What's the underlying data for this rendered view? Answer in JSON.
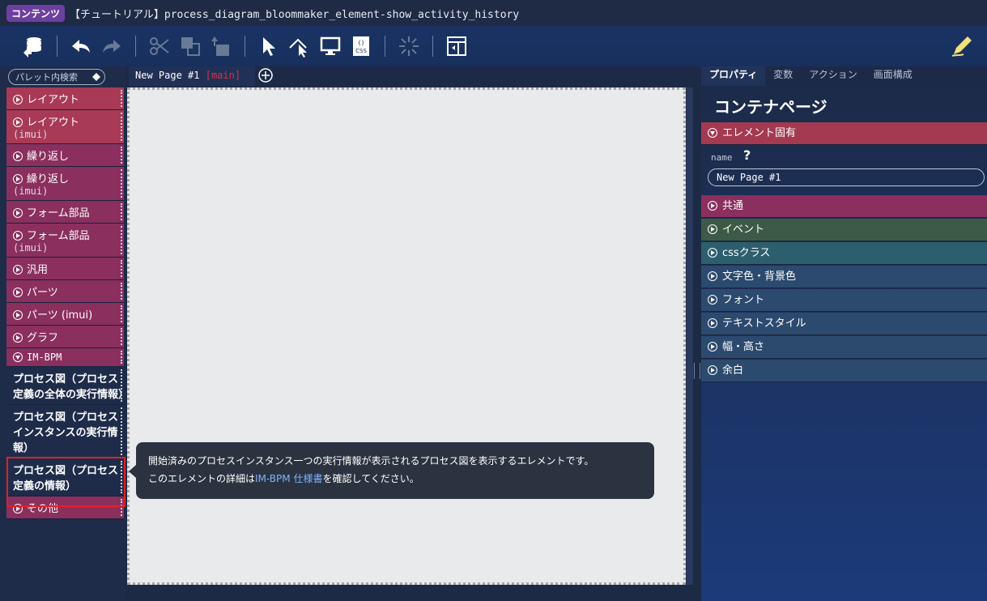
{
  "title": {
    "badge": "コンテンツ",
    "text": "【チュートリアル】process_diagram_bloommaker_element-show_activity_history"
  },
  "toolbar": {
    "icons": [
      "database-export-icon",
      "undo-icon",
      "redo-icon",
      "cut-icon",
      "copy-icon",
      "paste-icon",
      "select-cursor-icon",
      "select-area-icon",
      "preview-monitor-icon",
      "css-icon",
      "loading-icon",
      "page-layout-icon",
      "edit-pen-icon"
    ]
  },
  "palette": {
    "search_placeholder": "パレット内検索",
    "items": [
      {
        "label": "レイアウト",
        "sub": ""
      },
      {
        "label": "レイアウト",
        "sub": "(imui)"
      },
      {
        "label": "繰り返し",
        "sub": ""
      },
      {
        "label": "繰り返し",
        "sub": "(imui)"
      },
      {
        "label": "フォーム部品",
        "sub": ""
      },
      {
        "label": "フォーム部品",
        "sub": "(imui)"
      },
      {
        "label": "汎用",
        "sub": ""
      },
      {
        "label": "パーツ",
        "sub": ""
      },
      {
        "label": "パーツ (imui)",
        "sub": ""
      },
      {
        "label": "グラフ",
        "sub": ""
      },
      {
        "label": "IM-BPM",
        "sub": ""
      }
    ],
    "bpm_items": [
      "プロセス図（プロセス定義の全体の実行情報）",
      "プロセス図（プロセスインスタンスの実行情報）",
      "プロセス図（プロセス定義の情報）"
    ],
    "other": "その他"
  },
  "canvas": {
    "tab_label": "New Page #1",
    "tab_suffix": "[main]"
  },
  "tooltip": {
    "line1": "開始済みのプロセスインスタンス一つの実行情報が表示されるプロセス図を表示するエレメントです。",
    "line2_pre": "このエレメントの詳細は",
    "line2_link": "IM-BPM 仕様書",
    "line2_post": "を確認してください。"
  },
  "props": {
    "tabs": [
      "プロパティ",
      "変数",
      "アクション",
      "画面構成"
    ],
    "title": "コンテナページ",
    "element_section": "エレメント固有",
    "name_label": "name",
    "name_help": "?",
    "name_value": "New Page #1",
    "sections": [
      "共通",
      "イベント",
      "cssクラス",
      "文字色・背景色",
      "フォント",
      "テキストスタイル",
      "幅・高さ",
      "余白"
    ]
  },
  "colors": {
    "element": "#a33a52",
    "common": "#8b2f5f",
    "event": "#3d5a47",
    "css": "#2d5e6e",
    "other": "#2c4a6e"
  }
}
